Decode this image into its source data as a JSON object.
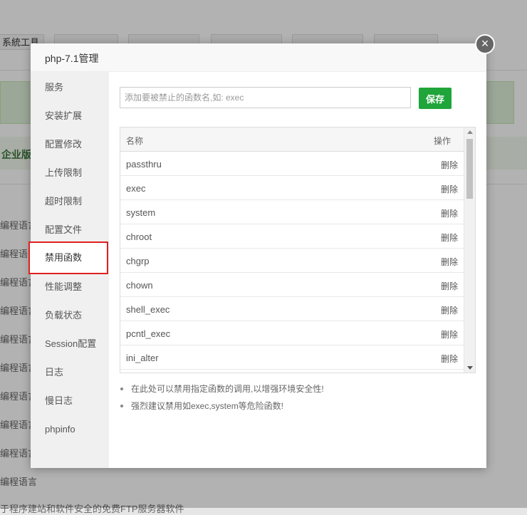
{
  "background": {
    "tabs": [
      "系統工具",
      "",
      "",
      "",
      "",
      "",
      ""
    ],
    "band_label": "企业版",
    "rows": [
      "编程语言",
      "编程语言",
      "编程语言",
      "编程语言",
      "编程语言",
      "编程语言",
      "编程语言",
      "编程语言",
      "编程语言",
      "编程语言"
    ],
    "footer_text": "于程序建站和软件安全的免费FTP服务器软件"
  },
  "dialog": {
    "title": "php-7.1管理",
    "close_label": "×"
  },
  "sidebar": {
    "items": [
      {
        "label": "服务"
      },
      {
        "label": "安装扩展"
      },
      {
        "label": "配置修改"
      },
      {
        "label": "上传限制"
      },
      {
        "label": "超时限制"
      },
      {
        "label": "配置文件"
      },
      {
        "label": "禁用函数"
      },
      {
        "label": "性能调整"
      },
      {
        "label": "负载状态"
      },
      {
        "label": "Session配置"
      },
      {
        "label": "日志"
      },
      {
        "label": "慢日志"
      },
      {
        "label": "phpinfo"
      }
    ],
    "active_index": 6
  },
  "form": {
    "placeholder": "添加要被禁止的函数名,如: exec",
    "value": "",
    "save_label": "保存"
  },
  "table": {
    "headers": {
      "name": "名称",
      "op": "操作"
    },
    "rows": [
      {
        "name": "passthru",
        "op": "删除"
      },
      {
        "name": "exec",
        "op": "删除"
      },
      {
        "name": "system",
        "op": "删除"
      },
      {
        "name": "chroot",
        "op": "删除"
      },
      {
        "name": "chgrp",
        "op": "删除"
      },
      {
        "name": "chown",
        "op": "删除"
      },
      {
        "name": "shell_exec",
        "op": "删除"
      },
      {
        "name": "pcntl_exec",
        "op": "删除"
      },
      {
        "name": "ini_alter",
        "op": "删除"
      }
    ]
  },
  "tips": [
    "在此处可以禁用指定函数的调用,以增强环境安全性!",
    "强烈建议禁用如exec,system等危险函数!"
  ],
  "colors": {
    "accent": "#20a53a",
    "active_outline": "#e02020"
  }
}
